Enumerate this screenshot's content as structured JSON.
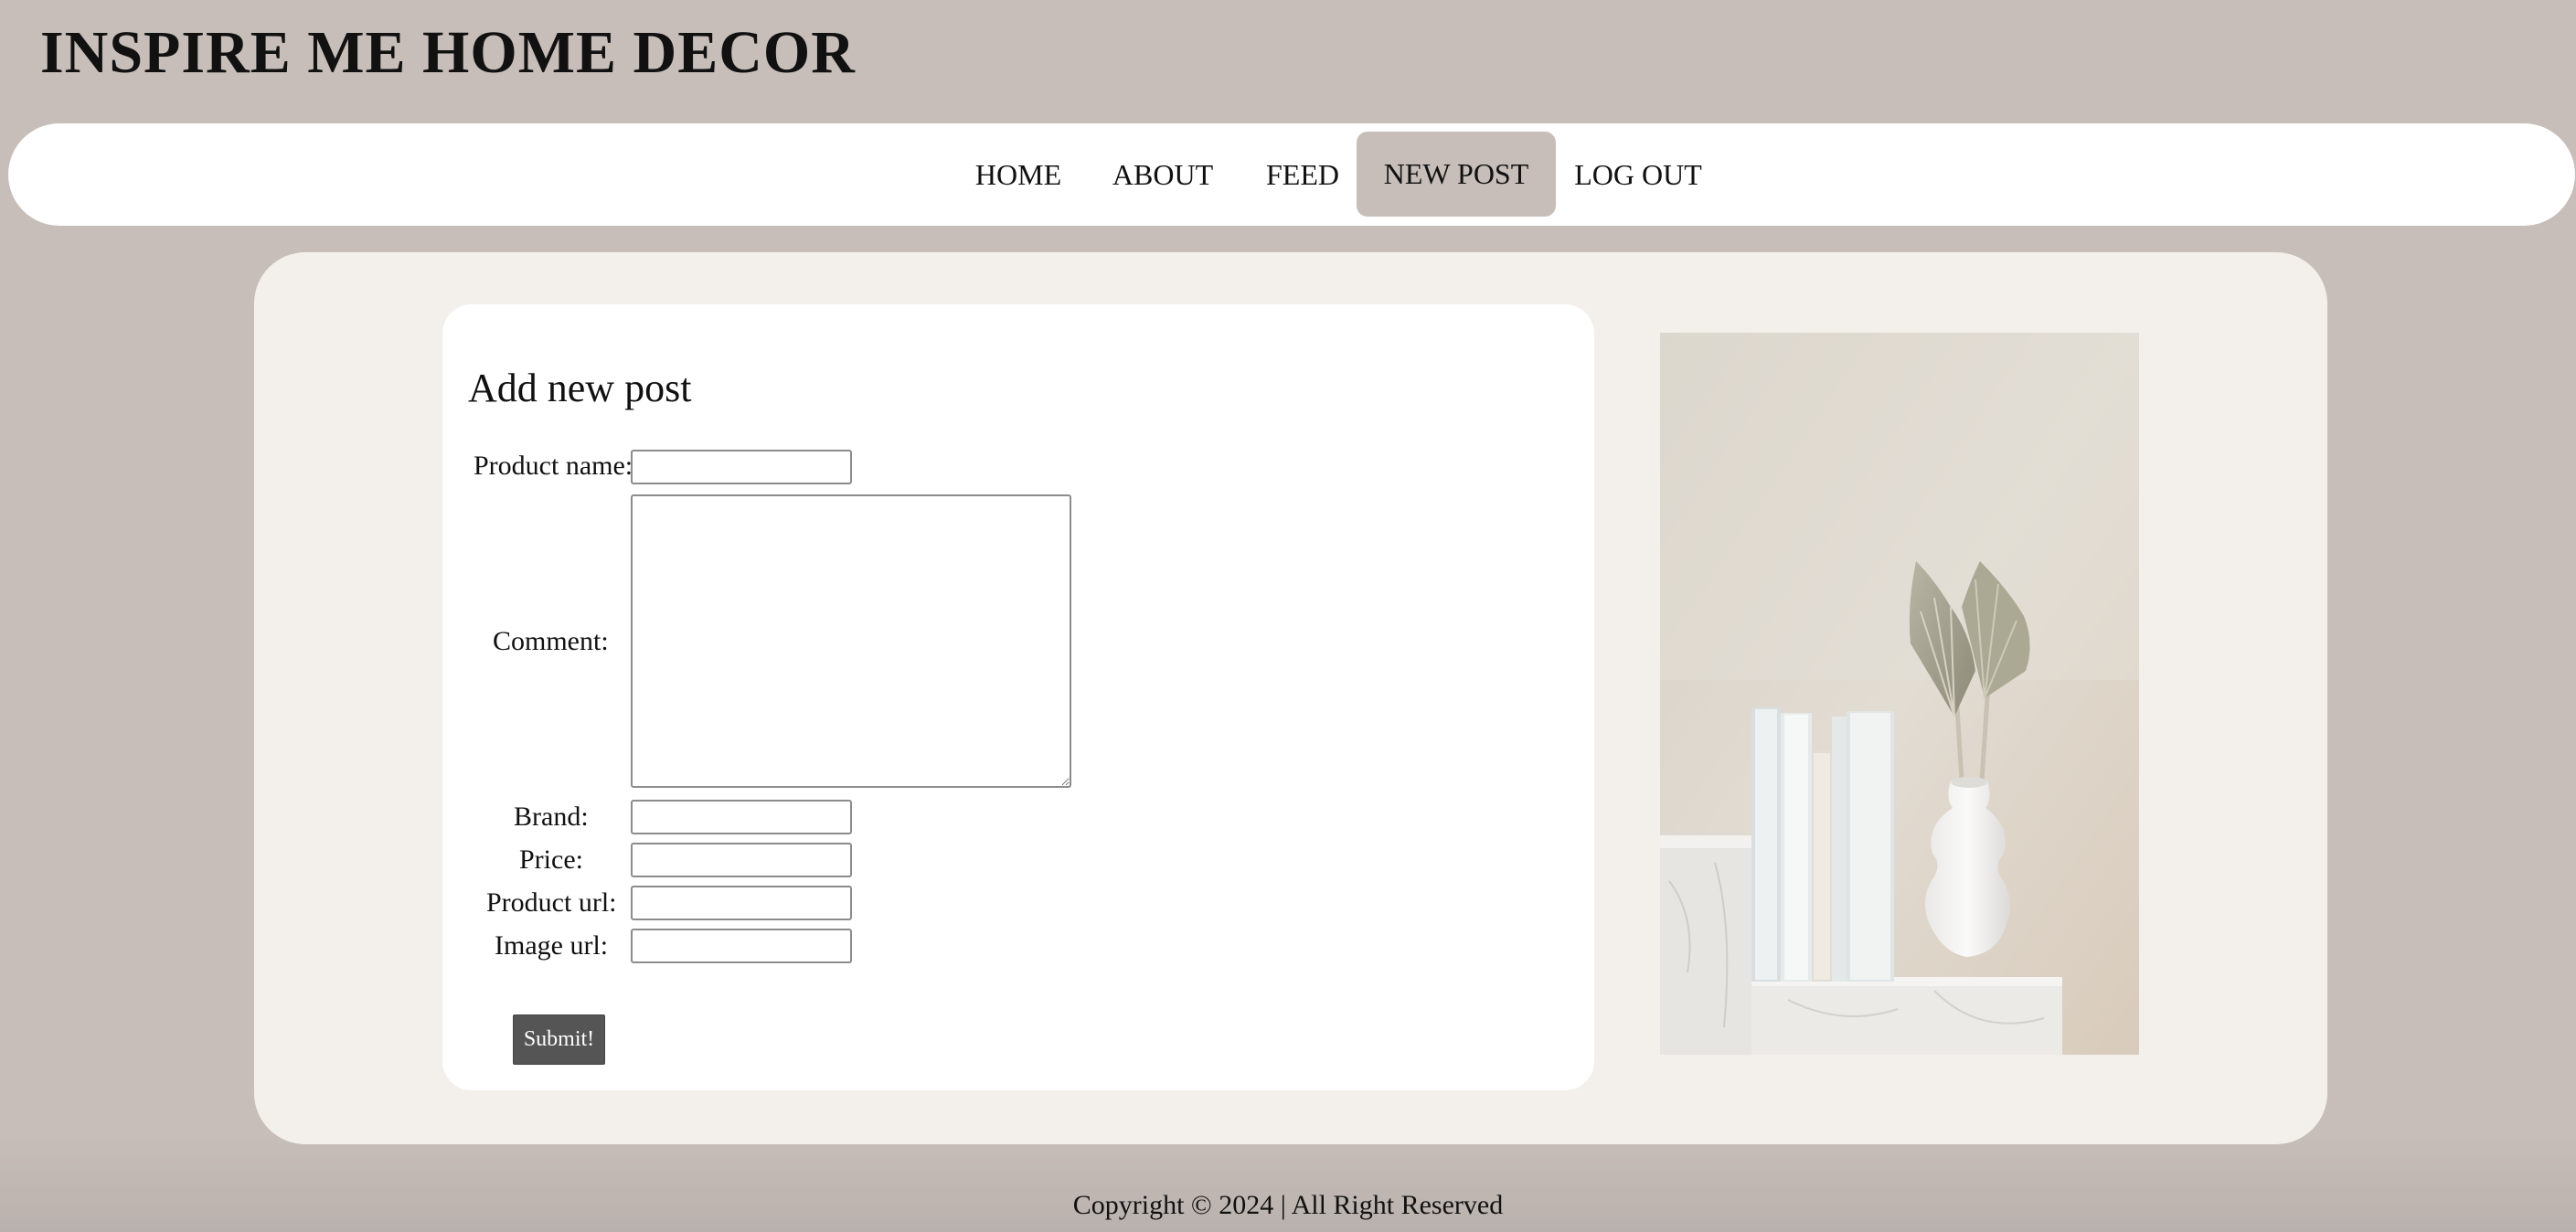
{
  "site": {
    "title": "INSPIRE ME HOME DECOR"
  },
  "nav": {
    "items": [
      {
        "label": "HOME"
      },
      {
        "label": "ABOUT"
      },
      {
        "label": "FEED"
      },
      {
        "label": "NEW POST"
      },
      {
        "label": "LOG OUT"
      }
    ],
    "active": "NEW POST",
    "active_color": "#c7beb9"
  },
  "form": {
    "heading": "Add new post",
    "fields": {
      "product_name": {
        "label": "Product name:",
        "value": ""
      },
      "comment": {
        "label": "Comment:",
        "value": ""
      },
      "brand": {
        "label": "Brand:",
        "value": ""
      },
      "price": {
        "label": "Price:",
        "value": ""
      },
      "product_url": {
        "label": "Product url:",
        "value": ""
      },
      "image_url": {
        "label": "Image url:",
        "value": ""
      }
    },
    "submit_label": "Submit!"
  },
  "image": {
    "alt": "books-and-vase-decor-photo-icon"
  },
  "footer": {
    "copyright": "Copyright © 2024 | All Right Reserved"
  },
  "colors": {
    "background": "#c7beb9",
    "card": "#f3f0ec",
    "button": "#555555"
  }
}
